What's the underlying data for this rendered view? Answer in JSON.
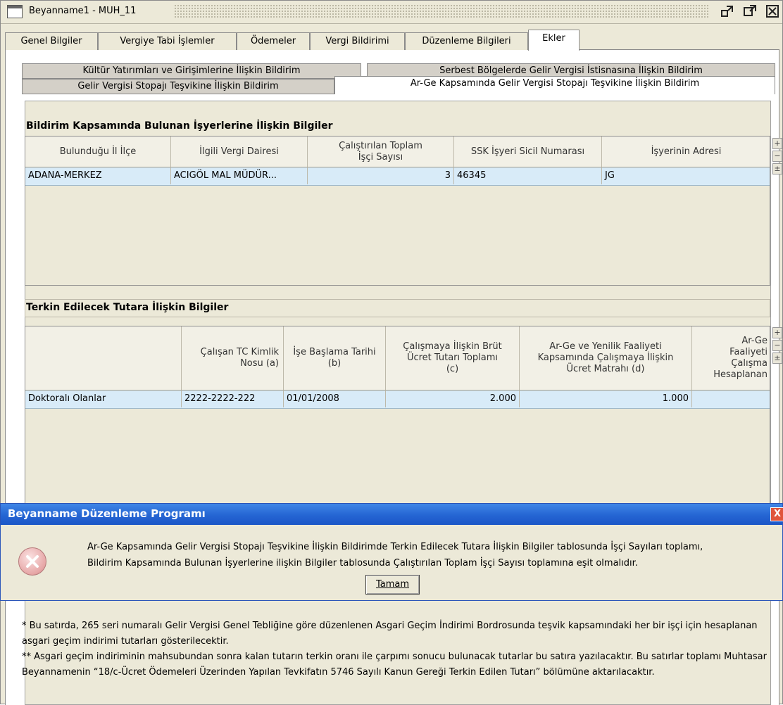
{
  "window": {
    "title": "Beyanname1 - MUH_11",
    "controls": [
      "▫",
      "▫",
      "⊠"
    ]
  },
  "main_tabs": [
    {
      "label": "Genel Bilgiler",
      "active": false
    },
    {
      "label": "Vergiye Tabi İşlemler",
      "active": false
    },
    {
      "label": "Ödemeler",
      "active": false
    },
    {
      "label": "Vergi Bildirimi",
      "active": false
    },
    {
      "label": "Düzenleme Bilgileri",
      "active": false
    },
    {
      "label": "Ekler",
      "active": true
    }
  ],
  "sub_tabs": {
    "row1": [
      "Kültür Yatırımları ve Girişimlerine İlişkin Bildirim",
      "Serbest Bölgelerde Gelir Vergisi İstisnasına İlişkin Bildirim"
    ],
    "row2": [
      "Gelir Vergisi Stopajı Teşvikine İlişkin Bildirim",
      "Ar-Ge Kapsamında Gelir Vergisi Stopajı Teşvikine İlişkin Bildirim"
    ]
  },
  "section1": {
    "title": "Bildirim Kapsamında Bulunan İşyerlerine İlişkin Bilgiler",
    "headers": [
      "Bulunduğu İl İlçe",
      "İlgili Vergi Dairesi",
      "Çalıştırılan Toplam İşçi Sayısı",
      "SSK İşyeri Sicil Numarası",
      "İşyerinin Adresi"
    ],
    "rows": [
      [
        "ADANA-MERKEZ",
        "ACIGÖL MAL MÜDÜR...",
        "3",
        "46345",
        "JG"
      ]
    ],
    "side_buttons": [
      "+",
      "−",
      "±"
    ]
  },
  "section2": {
    "title": "Terkin Edilecek Tutara İlişkin Bilgiler",
    "headers": [
      "",
      "Çalışan TC Kimlik Nosu (a)",
      "İşe Başlama Tarihi (b)",
      "Çalışmaya İlişkin Brüt Ücret Tutarı Toplamı (c)",
      "Ar-Ge ve Yenilik Faaliyeti Kapsamında Çalışmaya İlişkin Ücret Matrahı (d)",
      "Ar-Ge Faaliyeti Çalışma Hesaplanan"
    ],
    "rows": [
      [
        "Doktoralı Olanlar",
        "2222-2222-222",
        "01/01/2008",
        "2.000",
        "1.000",
        ""
      ]
    ],
    "side_buttons": [
      "+",
      "−",
      "±"
    ]
  },
  "dialog": {
    "title": "Beyanname Düzenleme Programı",
    "message_line1": "Ar-Ge Kapsamında Gelir Vergisi Stopajı Teşvikine İlişkin Bildirimde Terkin Edilecek Tutara İlişkin Bilgiler tablosunda İşçi Sayıları toplamı,",
    "message_line2": "Bildirim Kapsamında Bulunan İşyerlerine ilişkin Bilgiler tablosunda Çalıştırılan Toplam İşçi Sayısı toplamına eşit olmalıdır.",
    "ok_label": "Tamam",
    "close": "X"
  },
  "notes": {
    "note1": "* Bu satırda, 265 seri numaralı Gelir Vergisi Genel Tebliğine göre düzenlenen Asgari Geçim İndirimi Bordrosunda teşvik kapsamındaki her bir işçi için hesaplanan asgari geçim indirimi tutarları gösterilecektir.",
    "note2": "** Asgari geçim indiriminin mahsubundan sonra kalan tutarın terkin oranı ile çarpımı sonucu bulunacak tutarlar bu satıra yazılacaktır. Bu satırlar toplamı Muhtasar Beyannamenin “18/c-Ücret Ödemeleri Üzerinden Yapılan Tevkifatın 5746 Sayılı Kanun Gereği Terkin Edilen Tutarı” bölümüne aktarılacaktır."
  }
}
